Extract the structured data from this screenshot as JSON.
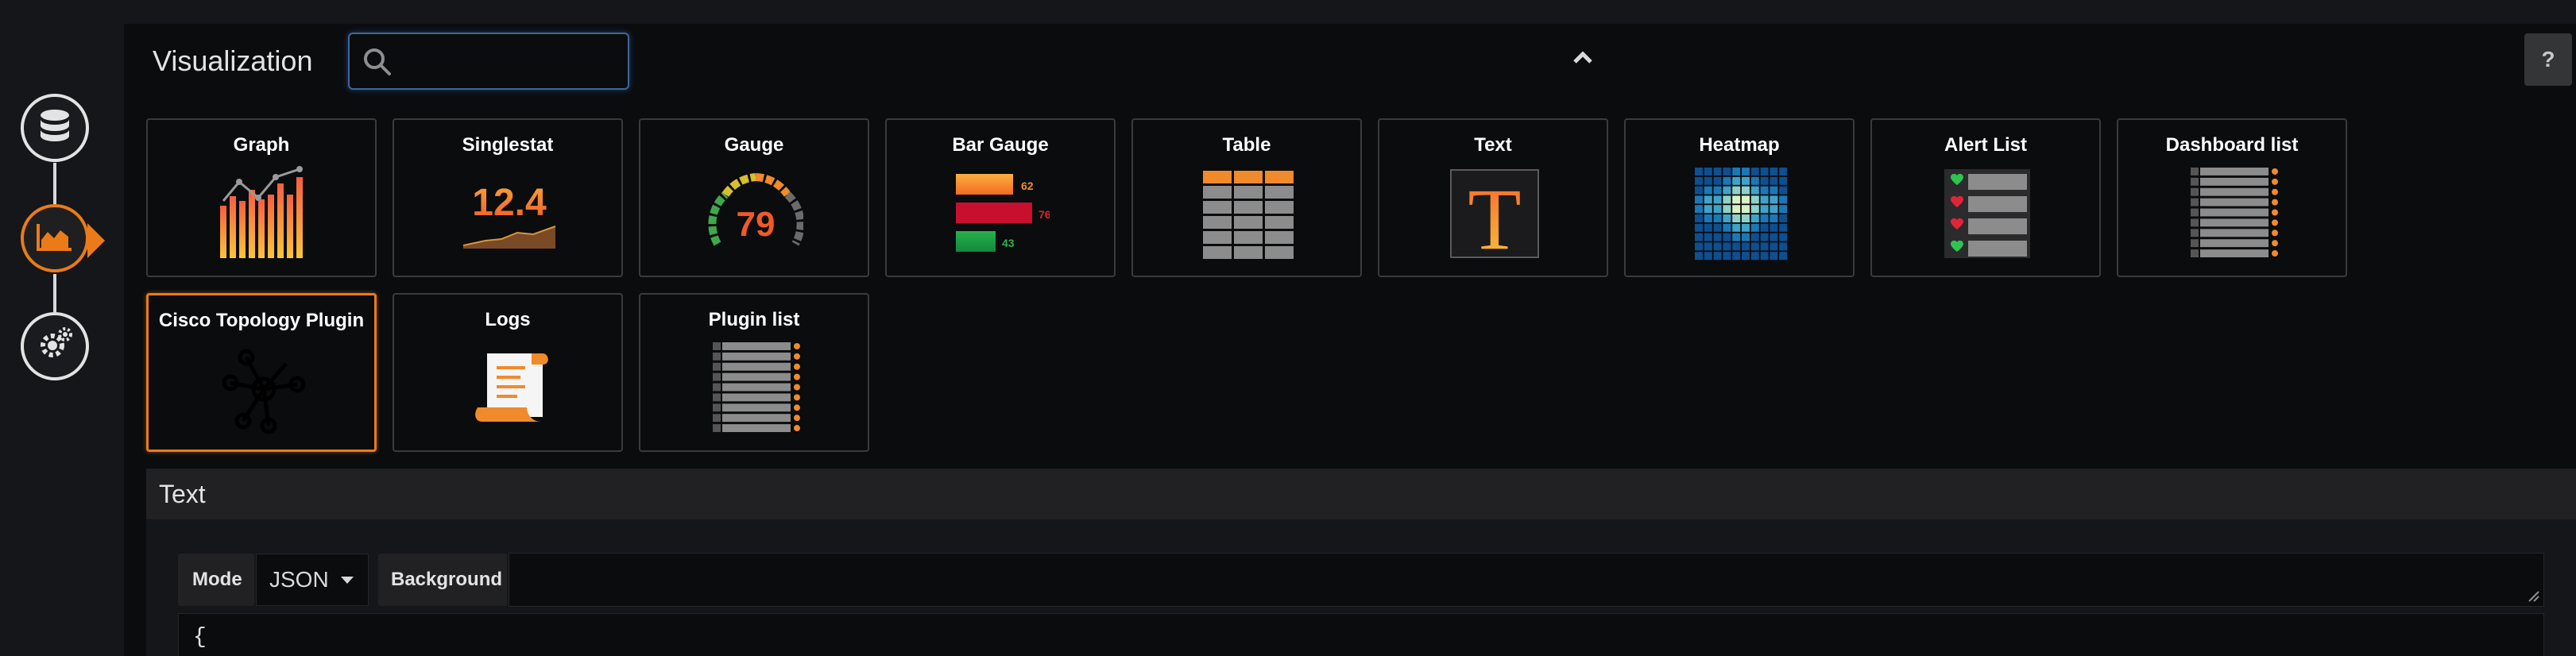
{
  "header": {
    "title": "Visualization",
    "search_placeholder": ""
  },
  "visualizations": [
    {
      "id": "graph",
      "label": "Graph"
    },
    {
      "id": "singlestat",
      "label": "Singlestat",
      "value_text": "12.4"
    },
    {
      "id": "gauge",
      "label": "Gauge",
      "value_text": "79"
    },
    {
      "id": "bar-gauge",
      "label": "Bar Gauge",
      "bar_values": [
        "62",
        "76",
        "43"
      ]
    },
    {
      "id": "table",
      "label": "Table"
    },
    {
      "id": "text",
      "label": "Text",
      "glyph": "T"
    },
    {
      "id": "heatmap",
      "label": "Heatmap"
    },
    {
      "id": "alert-list",
      "label": "Alert List"
    },
    {
      "id": "dashboard-list",
      "label": "Dashboard list"
    },
    {
      "id": "cisco-topology-plugin",
      "label": "Cisco Topology Plugin",
      "selected": true
    },
    {
      "id": "logs",
      "label": "Logs"
    },
    {
      "id": "plugin-list",
      "label": "Plugin list"
    }
  ],
  "options": {
    "section_title": "Text",
    "mode_label": "Mode",
    "mode_value": "JSON",
    "background_label": "Background",
    "background_value": "",
    "content_preview": "{"
  },
  "help_label": "?",
  "colors": {
    "accent": "#eb7b18",
    "focus": "#3f6797",
    "bg": "#0b0c0e"
  }
}
